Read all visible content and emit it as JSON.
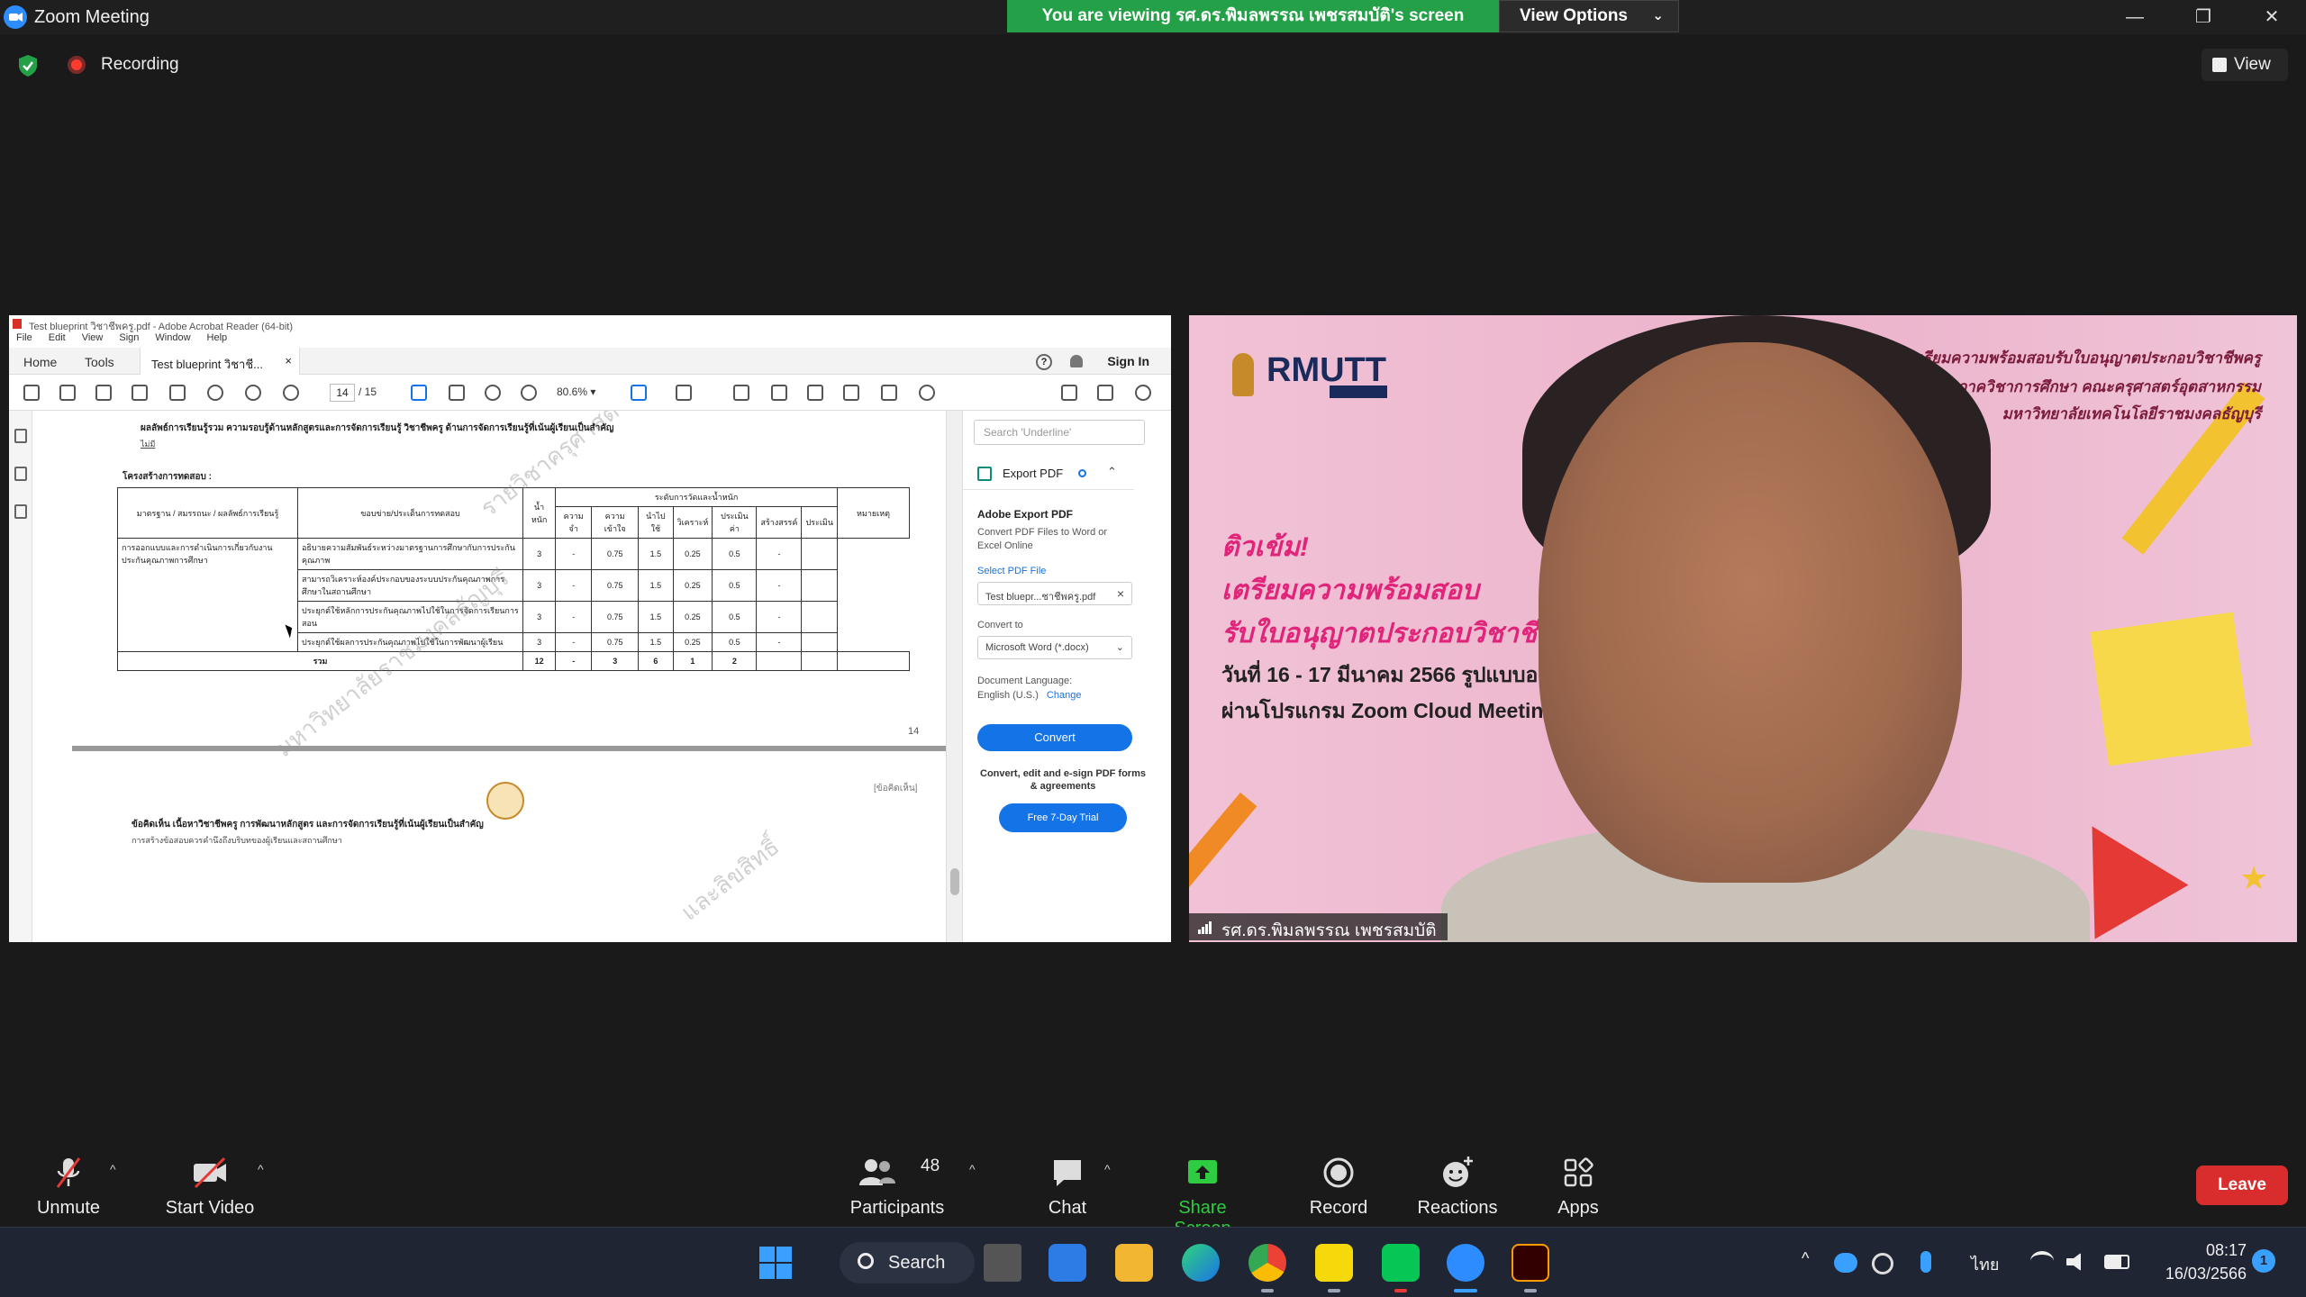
{
  "window": {
    "title": "Zoom Meeting",
    "minimize": "—",
    "restore": "❐",
    "close": "✕"
  },
  "banner": {
    "viewing": "You are viewing รศ.ดร.พิมลพรรณ เพชรสมบัติ's screen",
    "view_options": "View Options",
    "caret": "⌄"
  },
  "status": {
    "recording": "Recording",
    "view": "View"
  },
  "acrobat": {
    "title": "Test blueprint วิชาชีพครู.pdf - Adobe Acrobat Reader (64-bit)",
    "menu": [
      "File",
      "Edit",
      "View",
      "Sign",
      "Window",
      "Help"
    ],
    "tabs": {
      "home": "Home",
      "tools": "Tools",
      "doc": "Test blueprint วิชาชี...",
      "close": "×",
      "sign_in": "Sign In",
      "help": "?"
    },
    "toolbar": {
      "page_current": "14",
      "page_total": "/ 15",
      "zoom": "80.6%",
      "zoom_caret": "▾"
    },
    "document": {
      "heading": "ผลลัพธ์การเรียนรู้รวม ความรอบรู้ด้านหลักสูตรและการจัดการเรียนรู้ วิชาชีพครู ด้านการจัดการเรียนรู้ที่เน้นผู้เรียนเป็นสำคัญ",
      "sub": "ไม่มี",
      "structure_label": "โครงสร้างการทดสอบ :",
      "table_headers": [
        "มาตรฐาน / สมรรถนะ / ผลลัพธ์การเรียนรู้",
        "ขอบข่าย/ประเด็นการทดสอบ",
        "น้ำหนัก",
        "ความจำ",
        "ความเข้าใจ",
        "นำไปใช้",
        "วิเคราะห์",
        "ประเมินค่า",
        "สร้างสรรค์",
        "ประเมิน",
        "หมายเหตุ"
      ],
      "weight_group": "ระดับการวัดและน้ำหนัก",
      "standard_text": "การออกแบบและการดำเนินการเกี่ยวกับงานประกันคุณภาพการศึกษา",
      "rows": [
        {
          "scope": "อธิบายความสัมพันธ์ระหว่างมาตรฐานการศึกษากับการประกันคุณภาพ",
          "w": "3",
          "a": "-",
          "b": "0.75",
          "c": "1.5",
          "d": "0.25",
          "e": "0.5",
          "f": "-"
        },
        {
          "scope": "สามารถวิเคราะห์องค์ประกอบของระบบประกันคุณภาพการศึกษาในสถานศึกษา",
          "w": "3",
          "a": "-",
          "b": "0.75",
          "c": "1.5",
          "d": "0.25",
          "e": "0.5",
          "f": "-"
        },
        {
          "scope": "ประยุกต์ใช้หลักการประกันคุณภาพไปใช้ในการจัดการเรียนการสอน",
          "w": "3",
          "a": "-",
          "b": "0.75",
          "c": "1.5",
          "d": "0.25",
          "e": "0.5",
          "f": "-"
        },
        {
          "scope": "ประยุกต์ใช้ผลการประกันคุณภาพไปใช้ในการพัฒนาผู้เรียน",
          "w": "3",
          "a": "-",
          "b": "0.75",
          "c": "1.5",
          "d": "0.25",
          "e": "0.5",
          "f": "-"
        }
      ],
      "total": {
        "label": "รวม",
        "w": "12",
        "a": "-",
        "b": "3",
        "c": "6",
        "d": "1",
        "e": "2"
      },
      "page_number": "14",
      "seal_note": "[ข้อคิดเห็น]",
      "foot1": "ข้อคิดเห็น เนื้อหาวิชาชีพครู การพัฒนาหลักสูตร และการจัดการเรียนรู้ที่เน้นผู้เรียนเป็นสำคัญ",
      "foot2": "การสร้างข้อสอบควรคำนึงถึงบริบทของผู้เรียนและสถานศึกษา",
      "watermark1": "รายวิชาครุศาสตร์",
      "watermark2": "มหาวิทยาลัยราชมงคลธัญบุรี",
      "watermark3": "และลิขสิทธิ์"
    },
    "panel": {
      "search_placeholder": "Search 'Underline'",
      "export_label": "Export PDF",
      "export_caret": "⌃",
      "heading": "Adobe Export PDF",
      "desc": "Convert PDF Files to Word or Excel Online",
      "select": "Select PDF File",
      "file": "Test bluepr...ชาชีพครู.pdf",
      "file_close": "×",
      "convert_to": "Convert to",
      "format": "Microsoft Word (*.docx)",
      "format_caret": "⌄",
      "lang_label": "Document Language:",
      "lang": "English (U.S.)",
      "change": "Change",
      "convert": "Convert",
      "promo": "Convert, edit and e-sign PDF forms & agreements",
      "trial": "Free 7-Day Trial"
    }
  },
  "video": {
    "logo": "RMUTT",
    "right1": "การเตรียมความพร้อมสอบรับใบอนุญาตประกอบวิชาชีพครู",
    "right2": "ภาควิชาการศึกษา คณะครุศาสตร์อุตสาหกรรม",
    "right3": "มหาวิทยาลัยเทคโนโลยีราชมงคลธัญบุรี",
    "h1": "ติวเข้ม!",
    "h2": "เตรียมความพร้อมสอบ",
    "h3": "รับใบอนุญาตประกอบวิชาชีพครู",
    "d1": "วันที่ 16 - 17 มีนาคม 2566 รูปแบบออนไล",
    "d2": "ผ่านโปรแกรม Zoom Cloud Meetings",
    "star": "★",
    "participant_name": "รศ.ดร.พิมลพรรณ เพชรสมบัติ"
  },
  "controls": {
    "unmute": "Unmute",
    "start_video": "Start Video",
    "participants": "Participants",
    "participant_count": "48",
    "chat": "Chat",
    "share": "Share Screen",
    "record": "Record",
    "reactions": "Reactions",
    "apps": "Apps",
    "leave": "Leave",
    "caret": "^"
  },
  "taskbar": {
    "search": "Search",
    "lang": "ไทย",
    "time": "08:17",
    "date": "16/03/2566",
    "notifications": "1",
    "tray_up": "^"
  },
  "colors": {
    "accent_blue": "#2d8cff",
    "banner_green": "#24a148",
    "leave_red": "#d92d2d",
    "share_green": "#2ecc40"
  }
}
